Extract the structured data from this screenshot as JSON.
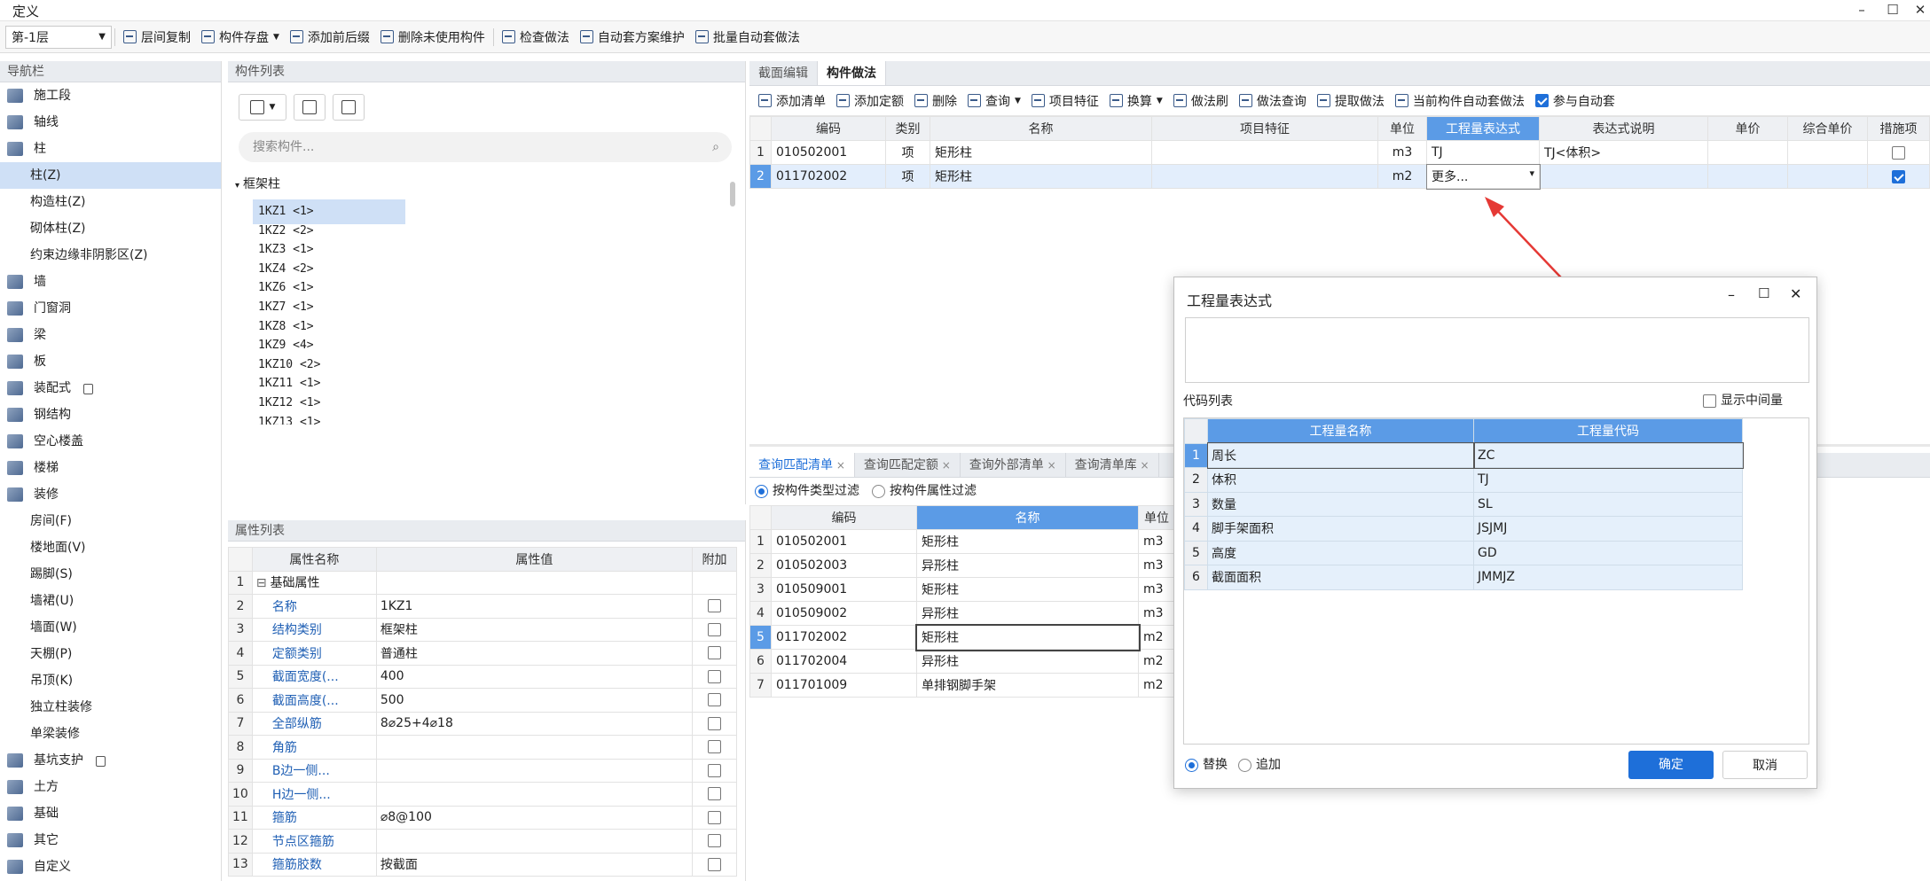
{
  "window": {
    "title": "定义"
  },
  "toolbar": {
    "floor": "第-1层",
    "items": [
      "层间复制",
      "构件存盘",
      "添加前后缀",
      "删除未使用构件",
      "检查做法",
      "自动套方案维护",
      "批量自动套做法"
    ]
  },
  "nav": {
    "title": "导航栏",
    "items": [
      {
        "label": "施工段",
        "sub": false
      },
      {
        "label": "轴线",
        "sub": false
      },
      {
        "label": "柱",
        "sub": false
      },
      {
        "label": "柱(Z)",
        "sub": true
      },
      {
        "label": "构造柱(Z)",
        "sub": true
      },
      {
        "label": "砌体柱(Z)",
        "sub": true
      },
      {
        "label": "约束边缘非阴影区(Z)",
        "sub": true
      },
      {
        "label": "墙",
        "sub": false
      },
      {
        "label": "门窗洞",
        "sub": false
      },
      {
        "label": "梁",
        "sub": false
      },
      {
        "label": "板",
        "sub": false
      },
      {
        "label": "装配式",
        "sub": false
      },
      {
        "label": "钢结构",
        "sub": false
      },
      {
        "label": "空心楼盖",
        "sub": false
      },
      {
        "label": "楼梯",
        "sub": false
      },
      {
        "label": "装修",
        "sub": false
      },
      {
        "label": "房间(F)",
        "sub": true
      },
      {
        "label": "楼地面(V)",
        "sub": true
      },
      {
        "label": "踢脚(S)",
        "sub": true
      },
      {
        "label": "墙裙(U)",
        "sub": true
      },
      {
        "label": "墙面(W)",
        "sub": true
      },
      {
        "label": "天棚(P)",
        "sub": true
      },
      {
        "label": "吊顶(K)",
        "sub": true
      },
      {
        "label": "独立柱装修",
        "sub": true
      },
      {
        "label": "单梁装修",
        "sub": true
      },
      {
        "label": "基坑支护",
        "sub": false
      },
      {
        "label": "土方",
        "sub": false
      },
      {
        "label": "基础",
        "sub": false
      },
      {
        "label": "其它",
        "sub": false
      },
      {
        "label": "自定义",
        "sub": false
      }
    ]
  },
  "complist": {
    "title": "构件列表",
    "search_placeholder": "搜索构件...",
    "group": "框架柱",
    "items": [
      "1KZ1 <1>",
      "1KZ2 <2>",
      "1KZ3 <1>",
      "1KZ4 <2>",
      "1KZ6 <1>",
      "1KZ7 <1>",
      "1KZ8 <1>",
      "1KZ9 <4>",
      "1KZ10 <2>",
      "1KZ11 <1>",
      "1KZ12 <1>",
      "1KZ13 <1>"
    ]
  },
  "props": {
    "title": "属性列表",
    "headers": [
      "属性名称",
      "属性值",
      "附加"
    ],
    "rows": [
      {
        "n": "1",
        "name": "基础属性",
        "value": "",
        "group": true
      },
      {
        "n": "2",
        "name": "名称",
        "value": "1KZ1"
      },
      {
        "n": "3",
        "name": "结构类别",
        "value": "框架柱"
      },
      {
        "n": "4",
        "name": "定额类别",
        "value": "普通柱"
      },
      {
        "n": "5",
        "name": "截面宽度(...",
        "value": "400"
      },
      {
        "n": "6",
        "name": "截面高度(...",
        "value": "500"
      },
      {
        "n": "7",
        "name": "全部纵筋",
        "value": "8⌀25+4⌀18"
      },
      {
        "n": "8",
        "name": "角筋",
        "value": ""
      },
      {
        "n": "9",
        "name": "B边一侧...",
        "value": ""
      },
      {
        "n": "10",
        "name": "H边一侧...",
        "value": ""
      },
      {
        "n": "11",
        "name": "箍筋",
        "value": "⌀8@100"
      },
      {
        "n": "12",
        "name": "节点区箍筋",
        "value": ""
      },
      {
        "n": "13",
        "name": "箍筋胶数",
        "value": "按截面"
      }
    ]
  },
  "work": {
    "tabs": [
      "截面编辑",
      "构件做法"
    ],
    "toolbar": [
      "添加清单",
      "添加定额",
      "删除",
      "查询",
      "项目特征",
      "换算",
      "做法刷",
      "做法查询",
      "提取做法",
      "当前构件自动套做法",
      "参与自动套"
    ],
    "headers": [
      "编码",
      "类别",
      "名称",
      "项目特征",
      "单位",
      "工程量表达式",
      "表达式说明",
      "单价",
      "综合单价",
      "措施项"
    ],
    "rows": [
      {
        "n": "1",
        "code": "010502001",
        "type": "项",
        "name": "矩形柱",
        "feat": "",
        "unit": "m3",
        "expr": "TJ",
        "desc": "TJ<体积>"
      },
      {
        "n": "2",
        "code": "011702002",
        "type": "项",
        "name": "矩形柱",
        "feat": "",
        "unit": "m2",
        "expr": "更多...",
        "desc": ""
      }
    ]
  },
  "query": {
    "tabs": [
      "查询匹配清单",
      "查询匹配定额",
      "查询外部清单",
      "查询清单库"
    ],
    "filter1": "按构件类型过滤",
    "filter2": "按构件属性过滤",
    "headers": [
      "编码",
      "名称",
      "单位"
    ],
    "rows": [
      {
        "n": "1",
        "code": "010502001",
        "name": "矩形柱",
        "unit": "m3"
      },
      {
        "n": "2",
        "code": "010502003",
        "name": "异形柱",
        "unit": "m3"
      },
      {
        "n": "3",
        "code": "010509001",
        "name": "矩形柱",
        "unit": "m3"
      },
      {
        "n": "4",
        "code": "010509002",
        "name": "异形柱",
        "unit": "m3"
      },
      {
        "n": "5",
        "code": "011702002",
        "name": "矩形柱",
        "unit": "m2"
      },
      {
        "n": "6",
        "code": "011702004",
        "name": "异形柱",
        "unit": "m2"
      },
      {
        "n": "7",
        "code": "011701009",
        "name": "单排钢脚手架",
        "unit": "m2"
      }
    ]
  },
  "dialog": {
    "title": "工程量表达式",
    "code_list": "代码列表",
    "show_intermediate": "显示中间量",
    "headers": [
      "工程量名称",
      "工程量代码"
    ],
    "rows": [
      {
        "n": "1",
        "name": "周长",
        "code": "ZC"
      },
      {
        "n": "2",
        "name": "体积",
        "code": "TJ"
      },
      {
        "n": "3",
        "name": "数量",
        "code": "SL"
      },
      {
        "n": "4",
        "name": "脚手架面积",
        "code": "JSJMJ"
      },
      {
        "n": "5",
        "name": "高度",
        "code": "GD"
      },
      {
        "n": "6",
        "name": "截面面积",
        "code": "JMMJZ"
      }
    ],
    "replace": "替换",
    "append": "追加",
    "ok": "确定",
    "cancel": "取消"
  },
  "colors": {
    "accent": "#1e6fd9",
    "header_highlight": "#5b9be6",
    "selection": "#cfe0f6",
    "arrow": "#e53935"
  }
}
